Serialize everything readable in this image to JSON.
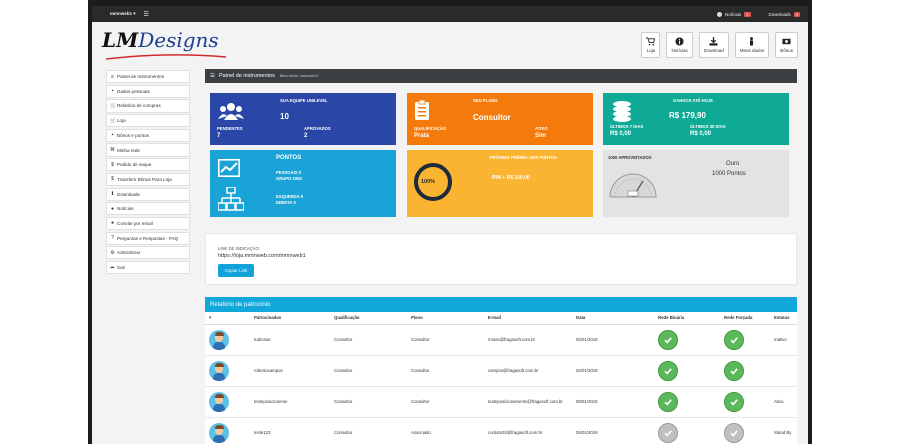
{
  "topbar": {
    "user": "mmnweb1 ▾",
    "noticias": "Notícias",
    "noticias_count": "1",
    "downloads": "Downloads",
    "downloads_count": "0"
  },
  "logo": {
    "lm": "LM",
    "rest": "Designs"
  },
  "header_buttons": [
    {
      "label": "Loja",
      "icon": "cart-icon"
    },
    {
      "label": "Notícias",
      "icon": "info-icon"
    },
    {
      "label": "Download",
      "icon": "download-icon"
    },
    {
      "label": "Meus dados",
      "icon": "person-icon"
    },
    {
      "label": "Bônus",
      "icon": "money-icon"
    }
  ],
  "sidebar": [
    {
      "label": "Painel de Instrumentos",
      "icon": "≡"
    },
    {
      "label": "Dados pessoais",
      "icon": "▪"
    },
    {
      "label": "Relatório de compras",
      "icon": "🛒"
    },
    {
      "label": "Loja",
      "icon": "🛒"
    },
    {
      "label": "Bônus e pontos",
      "icon": "▪"
    },
    {
      "label": "Minha rede",
      "icon": "⌘"
    },
    {
      "label": "Pedido de saque",
      "icon": "$"
    },
    {
      "label": "Transferir Bônus Para Loja",
      "icon": "$"
    },
    {
      "label": "Downloads",
      "icon": "⬇"
    },
    {
      "label": "Notícias",
      "icon": "●"
    },
    {
      "label": "Convite por email",
      "icon": "●"
    },
    {
      "label": "Perguntas e Respostas - FAQ",
      "icon": "?"
    },
    {
      "label": "Administrar",
      "icon": "⚙"
    },
    {
      "label": "Sair",
      "icon": "➦"
    }
  ],
  "panel": {
    "title": "Painel de instrumentos",
    "subtitle": "Bem vindo, mmnweb1!"
  },
  "cards": {
    "equipe": {
      "title": "SUA EQUIPE UNILEVEL",
      "total": "10",
      "pendentes_label": "PENDENTES",
      "pendentes": "7",
      "aprovados_label": "APROVADOS",
      "aprovados": "2"
    },
    "plano": {
      "title": "SEU PLANO",
      "name": "Consultor",
      "qualificacao_label": "QUALIFICAÇÃO",
      "qualificacao": "Prata",
      "ativo_label": "ATIVO",
      "ativo": "Sim"
    },
    "ganhos": {
      "title": "GANHOS ATÉ HOJE",
      "total": "R$ 179,90",
      "u7_label": "ÚLTIMOS 7 DIAS",
      "u7": "R$ 0,00",
      "u30_label": "ÚLTIMOS 30 DIAS",
      "u30": "R$ 0,00"
    },
    "pontos": {
      "title": "PONTOS",
      "pessoais": "PESSOAIS 0",
      "grupo": "GRUPO 1000",
      "esquerda": "ESQUERDA 0",
      "direita": "DIREITA 0"
    },
    "premio": {
      "title": "PRÓXIMO PRÊMIO 1000 PONTOS",
      "pct": "100%",
      "pct_value": 100,
      "text": "PIM + R$ 100,00"
    },
    "aproveitados": {
      "title": "1000 APROVEITADOS",
      "level": "Ouro",
      "points": "1000 Pontos"
    }
  },
  "link": {
    "label": "LINK DE INDICAÇÃO:",
    "url": "https://loja.mmnweb.com/mmnweb1",
    "button": "Copiar Link"
  },
  "report": {
    "title": "Relatório de patrocínio",
    "headers": [
      "#",
      "Patrocinados",
      "Qualificação",
      "Plano",
      "E-mail",
      "Data",
      "Rede Binária",
      "Rede Forçada",
      "Estatus"
    ],
    "rows": [
      {
        "name": "tudrosas",
        "qual": "Consultor",
        "plano": "Consultor",
        "email": "mrass@fragasoft.com.br",
        "data": "02/01/2019",
        "bin": true,
        "forc": true,
        "status": "Inativo"
      },
      {
        "name": "robertocampos",
        "qual": "Consultor",
        "plano": "Consultor",
        "email": "campos@fragasoft.com.br",
        "data": "02/01/2019",
        "bin": true,
        "forc": true,
        "status": ""
      },
      {
        "name": "testeposicioneme",
        "qual": "Consultor",
        "plano": "Consultor",
        "email": "testeposicionamento@fragasoft.com.br",
        "data": "09/01/2019",
        "bin": true,
        "forc": true,
        "status": "Ativo"
      },
      {
        "name": "teste123",
        "qual": "Consultor",
        "plano": "Associado",
        "email": "contato32@fragasoft.com.br",
        "data": "25/01/2019",
        "bin": false,
        "forc": false,
        "status": "Stand By"
      }
    ]
  }
}
